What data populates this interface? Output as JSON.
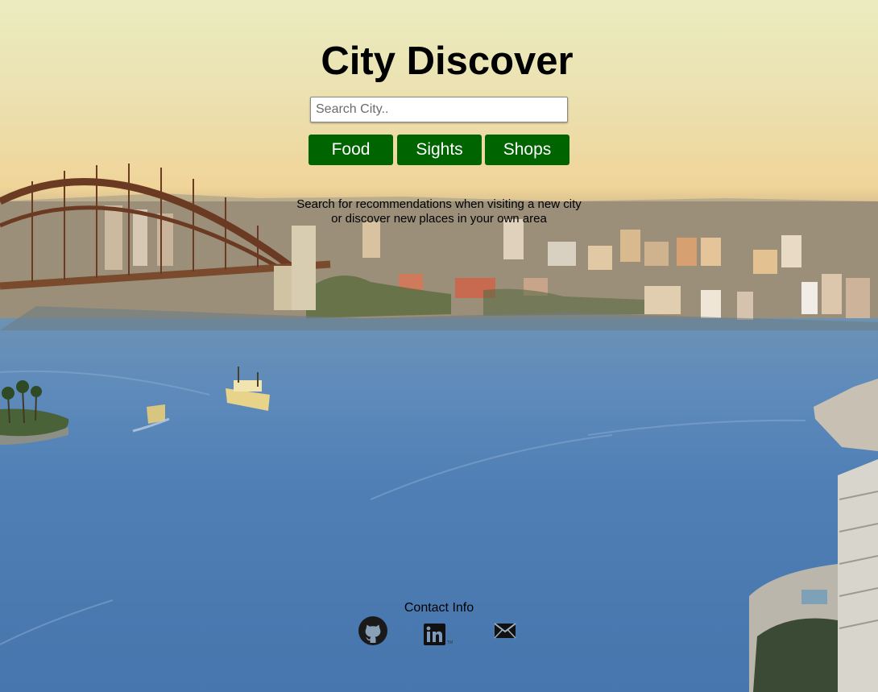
{
  "header": {
    "title": "City Discover"
  },
  "search": {
    "placeholder": "Search City..",
    "value": ""
  },
  "categories": [
    {
      "label": "Food"
    },
    {
      "label": "Sights"
    },
    {
      "label": "Shops"
    }
  ],
  "tagline": "Search for recommendations when visiting a new city or discover new places in your own area",
  "footer": {
    "contact_label": "Contact Info",
    "icons": [
      "github-icon",
      "linkedin-icon",
      "email-icon"
    ]
  },
  "colors": {
    "button_bg": "#006400",
    "button_text": "#ffffff",
    "title_text": "#000000"
  }
}
